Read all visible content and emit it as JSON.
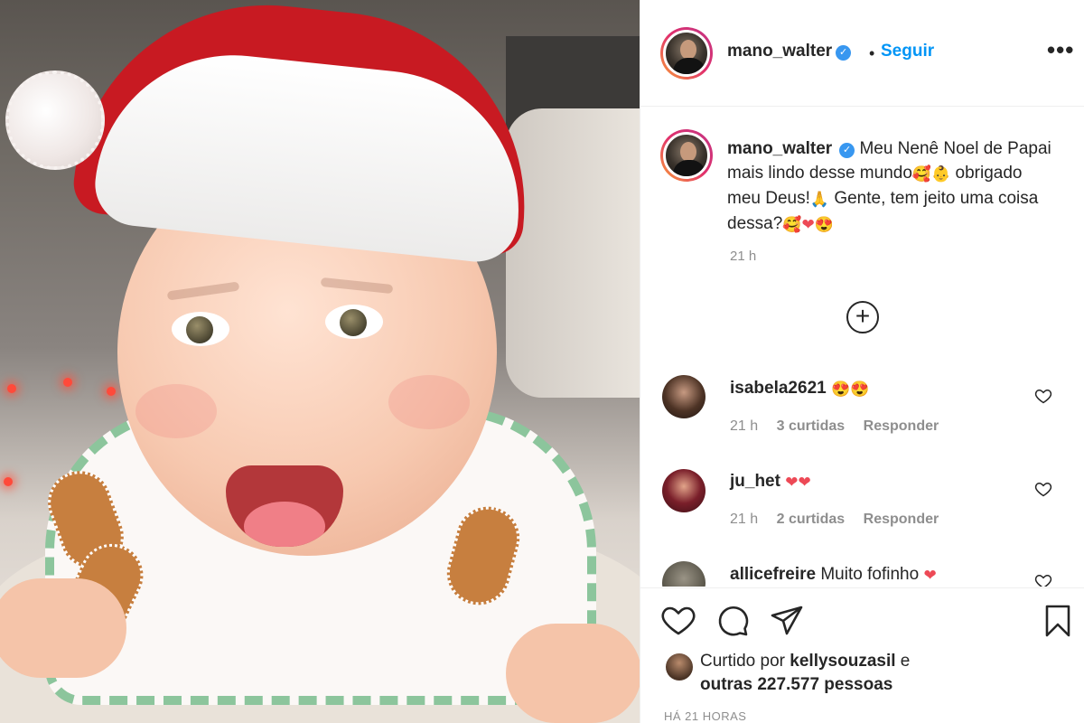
{
  "post": {
    "author": "mano_walter",
    "follow_label": "Seguir",
    "dot_separator": "•",
    "more_label": "•••",
    "caption_text": "Meu Nenê Noel de Papai mais lindo desse mundo",
    "caption_text_2": "obrigado meu Deus!",
    "caption_text_3": "Gente, tem jeito uma coisa dessa?",
    "caption_time": "21 h",
    "load_more_label": "+",
    "liked_by_prefix": "Curtido por",
    "liked_by_user": "kellysouzasil",
    "liked_by_conj": "e",
    "liked_by_others": "outras 227.577 pessoas",
    "post_age": "HÁ 21 HORAS"
  },
  "comments": [
    {
      "user": "isabela2621",
      "text": "",
      "time": "21 h",
      "likes": "3 curtidas",
      "reply": "Responder"
    },
    {
      "user": "ju_het",
      "text": "",
      "time": "21 h",
      "likes": "2 curtidas",
      "reply": "Responder"
    },
    {
      "user": "allicefreire",
      "text": "Muito fofinho",
      "time": "",
      "likes": "",
      "reply": ""
    }
  ],
  "colors": {
    "follow_blue": "#0095f6",
    "verified_blue": "#3897f0",
    "heart_red": "#ed4956"
  },
  "icons": [
    "verified-badge-icon",
    "like-icon",
    "comment-icon",
    "share-icon",
    "save-icon",
    "load-more-icon",
    "more-options-icon"
  ]
}
